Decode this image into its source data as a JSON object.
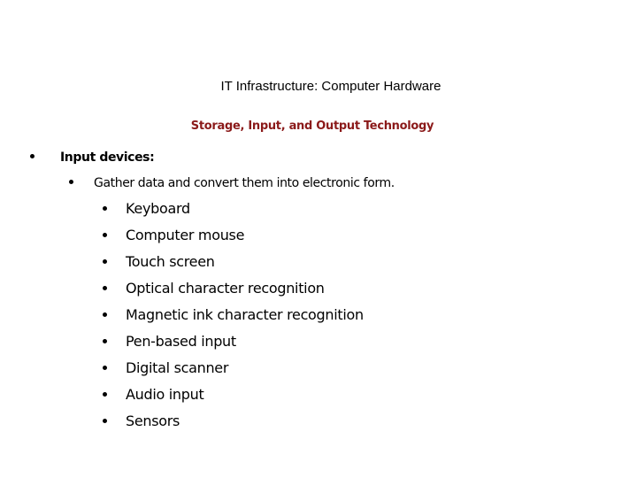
{
  "slide": {
    "title": "IT Infrastructure: Computer Hardware",
    "subtitle": "Storage, Input, and Output Technology",
    "subtitle_color": "#8B1A1A",
    "level1": {
      "bullet_icon": "bullet-dot",
      "text": "Input devices:"
    },
    "level2": {
      "bullet_icon": "bullet-dot",
      "text": "Gather data and convert them into electronic form."
    },
    "items": [
      "Keyboard",
      "Computer mouse",
      "Touch screen",
      "Optical character recognition",
      "Magnetic ink character recognition",
      "Pen-based input",
      "Digital scanner",
      "Audio input",
      "Sensors"
    ]
  }
}
